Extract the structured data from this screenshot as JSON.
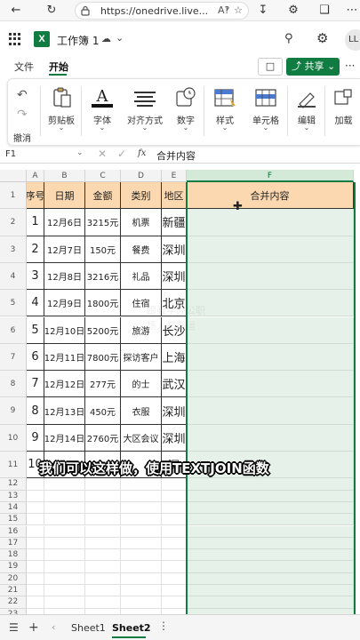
{
  "browser": {
    "url": "https://onedrive.live...",
    "back_icon": "arrow-left-icon",
    "refresh_icon": "refresh-icon"
  },
  "header": {
    "workbook_title": "工作簿 1",
    "avatar_initials": "LL"
  },
  "tabs": {
    "file": "文件",
    "home": "开始"
  },
  "toolbar": {
    "share_label": "共享",
    "more_label": "···"
  },
  "ribbon": {
    "undo_label": "撤消",
    "groups": [
      {
        "label": "剪贴板"
      },
      {
        "label": "字体"
      },
      {
        "label": "对齐方式"
      },
      {
        "label": "数字"
      },
      {
        "label": "样式"
      },
      {
        "label": "单元格"
      },
      {
        "label": "编辑"
      },
      {
        "label": "加载"
      }
    ]
  },
  "formula_bar": {
    "name_box": "F1",
    "formula": "合并内容"
  },
  "grid": {
    "columns": [
      "A",
      "B",
      "C",
      "D",
      "E",
      "F"
    ],
    "selected_column": "F",
    "row_numbers": [
      "1",
      "2",
      "3",
      "4",
      "5",
      "6",
      "7",
      "8",
      "9",
      "10",
      "11",
      "12",
      "13",
      "14",
      "15",
      "16",
      "17",
      "18",
      "19",
      "20",
      "21",
      "22",
      "23",
      "24",
      "25"
    ],
    "header_row": [
      "序号",
      "日期",
      "金额",
      "类别",
      "地区",
      "合并内容"
    ],
    "rows": [
      [
        "1",
        "12月6日",
        "3215元",
        "机票",
        "新疆"
      ],
      [
        "2",
        "12月7日",
        "150元",
        "餐费",
        "深圳"
      ],
      [
        "3",
        "12月8日",
        "3216元",
        "礼品",
        "深圳"
      ],
      [
        "4",
        "12月9日",
        "1800元",
        "住宿",
        "北京"
      ],
      [
        "5",
        "12月10日",
        "5200元",
        "旅游",
        "长沙"
      ],
      [
        "6",
        "12月11日",
        "7800元",
        "探访客户",
        "上海"
      ],
      [
        "7",
        "12月12日",
        "277元",
        "的士",
        "武汉"
      ],
      [
        "8",
        "12月13日",
        "450元",
        "衣服",
        "深圳"
      ],
      [
        "9",
        "12月14日",
        "2760元",
        "大区会议",
        "深圳"
      ],
      [
        "10",
        "",
        "",
        "",
        "深"
      ]
    ]
  },
  "overlay": {
    "subtitle": "我们可以这样做，使用TEXTJOIN函数",
    "watermark_line1": "跟我学办公职",
    "watermark_line2": "场人都搬运"
  },
  "sheets": {
    "sheet1": "Sheet1",
    "sheet2": "Sheet2",
    "active": "Sheet2"
  },
  "colors": {
    "excel_green": "#107c41",
    "header_fill": "#fbd8b0",
    "selected_column_fill": "#e6f1e9"
  }
}
